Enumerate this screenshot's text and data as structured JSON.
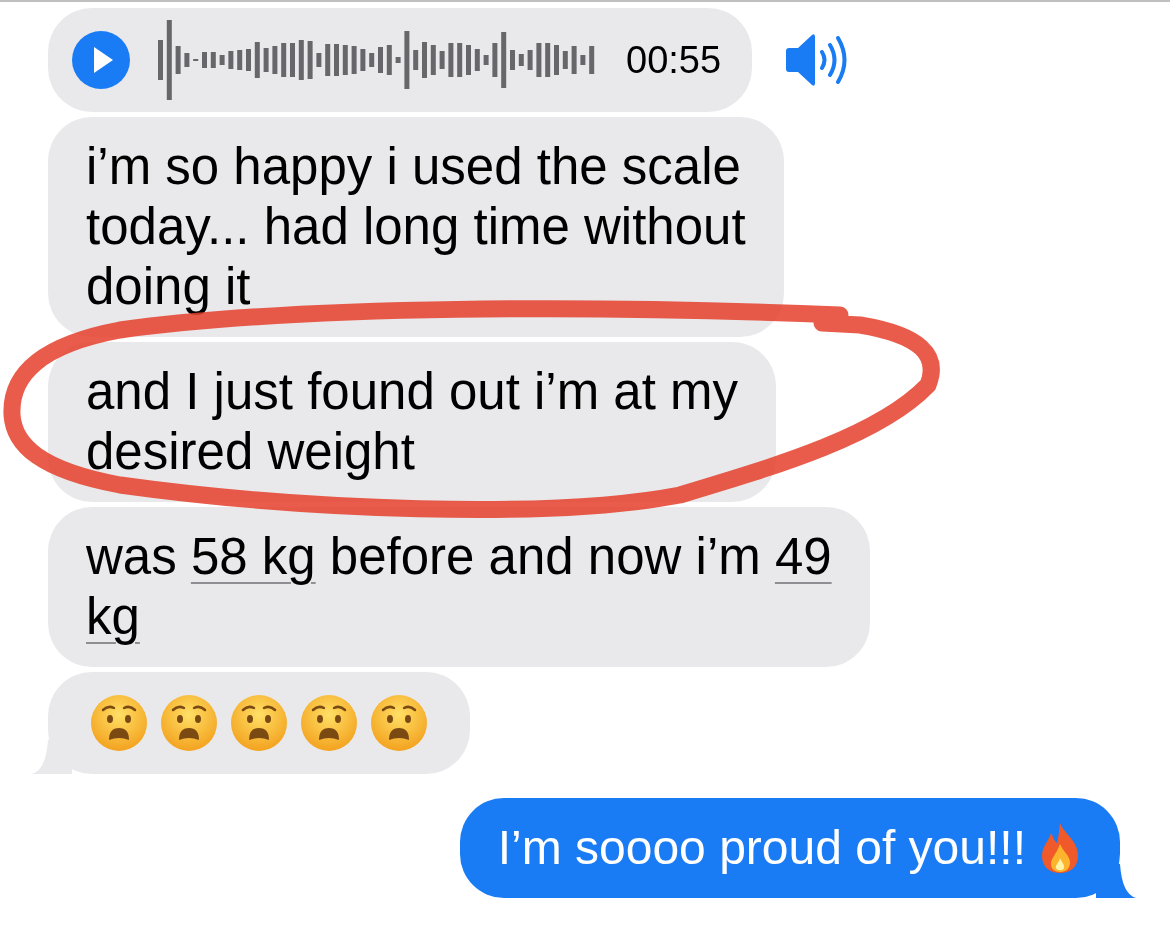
{
  "messages": [
    {
      "kind": "audio",
      "sent": false,
      "tail": false,
      "duration": "00:55"
    },
    {
      "kind": "text",
      "sent": false,
      "tail": false,
      "parts": [
        {
          "text": "i’m so happy i used the scale\ntoday... had long time without\ndoing it",
          "detected": false
        }
      ]
    },
    {
      "kind": "text",
      "sent": false,
      "tail": false,
      "parts": [
        {
          "text": "and I just found out i’m at my\ndesired weight",
          "detected": false
        }
      ]
    },
    {
      "kind": "text",
      "sent": false,
      "tail": false,
      "parts": [
        {
          "text": "was ",
          "detected": false
        },
        {
          "text": "58 kg",
          "detected": true
        },
        {
          "text": " before and now i’m ",
          "detected": false
        },
        {
          "text": "49\nkg",
          "detected": true
        }
      ]
    },
    {
      "kind": "emoji",
      "sent": false,
      "tail": true,
      "emojis": [
        {
          "kind": "anguished-face"
        },
        {
          "kind": "anguished-face"
        },
        {
          "kind": "anguished-face"
        },
        {
          "kind": "anguished-face"
        },
        {
          "kind": "anguished-face"
        }
      ]
    },
    {
      "kind": "text",
      "sent": true,
      "tail": true,
      "parts": [
        {
          "text": "I’m soooo proud of you!!!",
          "detected": false
        }
      ],
      "emojis": [
        {
          "kind": "fire"
        }
      ]
    }
  ]
}
